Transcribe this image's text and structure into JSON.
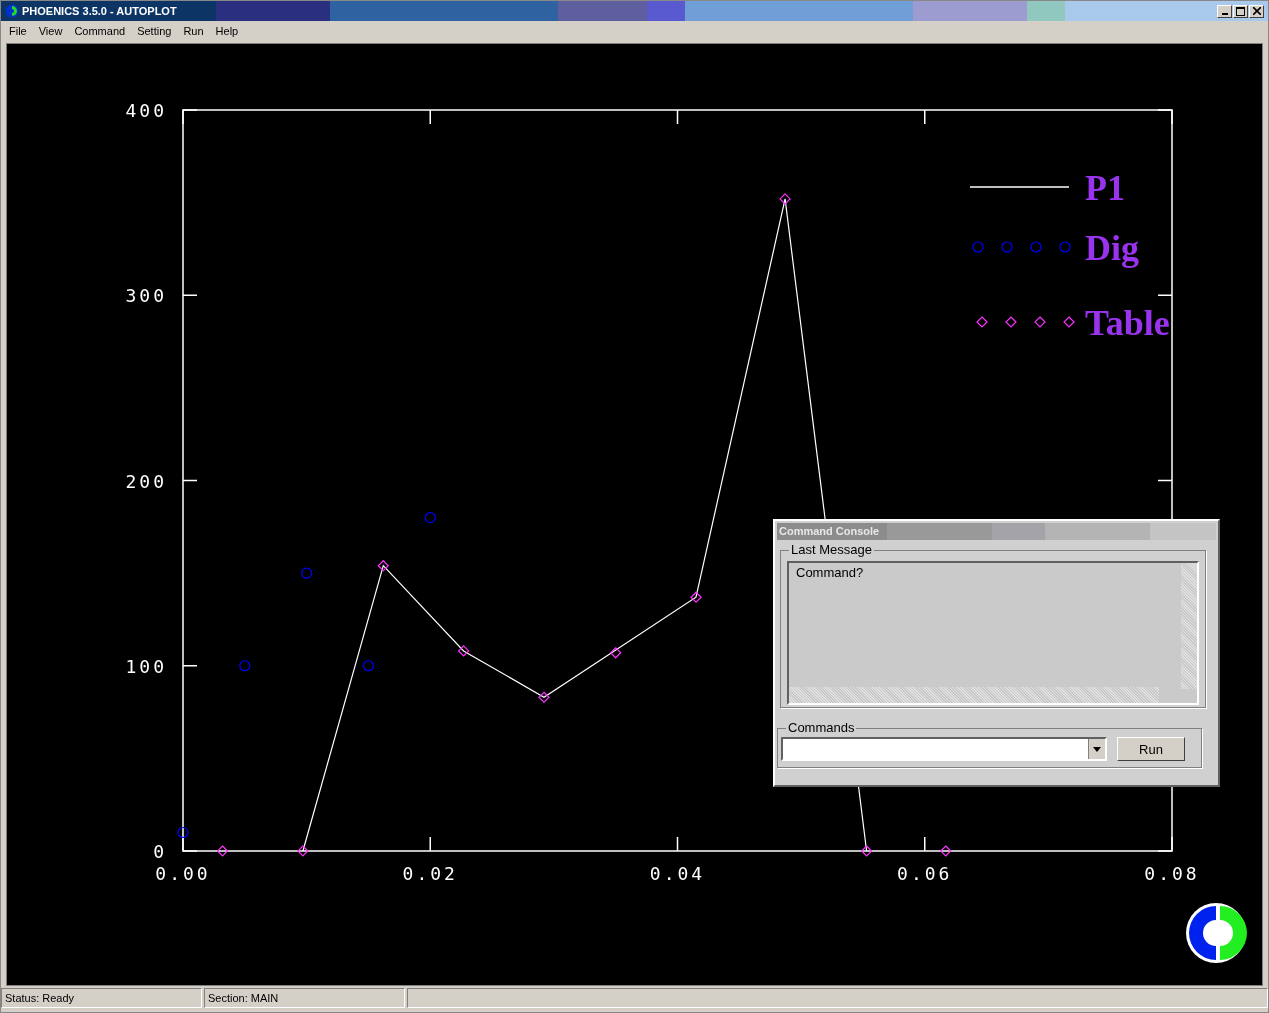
{
  "window": {
    "title": "PHOENICS 3.5.0 - AUTOPLOT"
  },
  "menu": [
    {
      "label": "File"
    },
    {
      "label": "View"
    },
    {
      "label": "Command"
    },
    {
      "label": "Setting"
    },
    {
      "label": "Run"
    },
    {
      "label": "Help"
    }
  ],
  "plot": {
    "chart_data": {
      "type": "line",
      "legend": "upper right",
      "xlim": [
        0,
        0.08
      ],
      "ylim": [
        0,
        400
      ],
      "xticks": [
        {
          "value": 0,
          "label": "0.00"
        },
        {
          "value": 0.02,
          "label": "0.02"
        },
        {
          "value": 0.04,
          "label": "0.04"
        },
        {
          "value": 0.06,
          "label": "0.06"
        },
        {
          "value": 0.08,
          "label": "0.08"
        }
      ],
      "yticks": [
        {
          "value": 0,
          "label": "0"
        },
        {
          "value": 100,
          "label": "100"
        },
        {
          "value": 200,
          "label": "200"
        },
        {
          "value": 300,
          "label": "300"
        },
        {
          "value": 400,
          "label": "400"
        }
      ],
      "series": [
        {
          "name": "P1",
          "type": "line",
          "color": "#ffffff",
          "x": [
            0.0097,
            0.0162,
            0.0227,
            0.0292,
            0.0415,
            0.0487,
            0.0553
          ],
          "values": [
            0,
            154,
            108,
            83,
            137,
            352,
            0
          ]
        },
        {
          "name": "Dig",
          "type": "scatter",
          "color": "#0000ff",
          "x": [
            0,
            0.005,
            0.01,
            0.015,
            0.02
          ],
          "values": [
            10,
            100,
            150,
            100,
            180
          ]
        },
        {
          "name": "Table",
          "type": "scatter",
          "color": "#ff33ff",
          "x": [
            0.0032,
            0.0097,
            0.0162,
            0.0227,
            0.0292,
            0.035,
            0.0415,
            0.0487,
            0.0553,
            0.0617
          ],
          "values": [
            0,
            0,
            154,
            108,
            83,
            107,
            137,
            352,
            0,
            0
          ]
        }
      ]
    },
    "markers": [
      {
        "kind": "line"
      },
      {
        "kind": "circle"
      },
      {
        "kind": "diamond"
      }
    ]
  },
  "console": {
    "title": "Command Console",
    "last_message": {
      "label": "Last Message",
      "text": "Command?"
    },
    "commands": {
      "label": "Commands"
    },
    "button": "Run"
  },
  "status_bar": [
    {
      "text": "Status: Ready"
    },
    {
      "text": "Section: MAIN"
    }
  ]
}
